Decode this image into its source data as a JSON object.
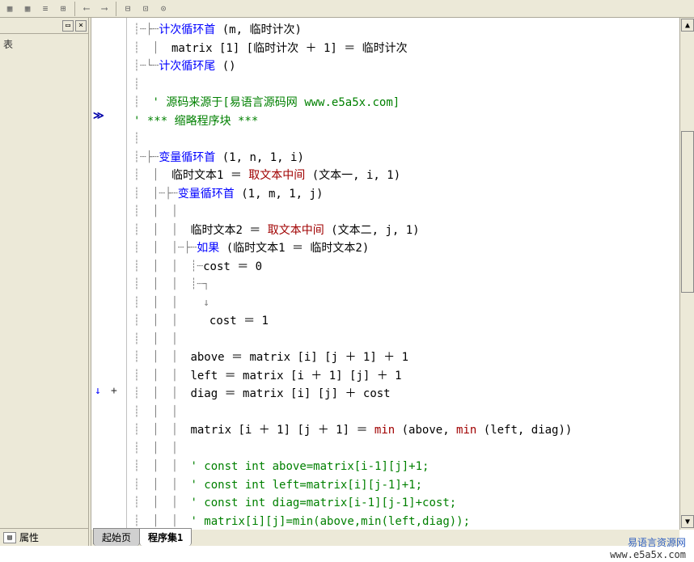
{
  "toolbar": {
    "tools": [
      "▦",
      "▦",
      "≡",
      "⊞",
      "|",
      "⟵",
      "⟶",
      "|",
      "⊟",
      "⊡",
      "⊙"
    ]
  },
  "leftPanel": {
    "hint": "表",
    "propTab": "属性"
  },
  "gutter": {
    "arrowLine": 20,
    "chevronLine": 5
  },
  "code": {
    "lines": [
      {
        "indent": "┊┄├┄",
        "parts": [
          {
            "c": "kw-blue",
            "t": "计次循环首"
          },
          {
            "c": "kw-black",
            "t": " (m, 临时计次)"
          }
        ]
      },
      {
        "indent": "┊  │  ",
        "parts": [
          {
            "c": "kw-black",
            "t": "matrix [1] [临时计次 ＋ 1] ＝ 临时计次"
          }
        ]
      },
      {
        "indent": "┊┄└┄",
        "parts": [
          {
            "c": "kw-blue",
            "t": "计次循环尾"
          },
          {
            "c": "kw-black",
            "t": " ()"
          }
        ]
      },
      {
        "indent": "┊",
        "parts": []
      },
      {
        "indent": "┊  ",
        "parts": [
          {
            "c": "kw-green",
            "t": "' 源码来源于[易语言源码网 www.e5a5x.com]"
          }
        ]
      },
      {
        "indent": "",
        "parts": [
          {
            "c": "kw-green",
            "t": "' *** 缩略程序块 ***"
          }
        ]
      },
      {
        "indent": "┊",
        "parts": []
      },
      {
        "indent": "┊┄├┄",
        "parts": [
          {
            "c": "kw-blue",
            "t": "变量循环首"
          },
          {
            "c": "kw-black",
            "t": " (1, n, 1, i)"
          }
        ]
      },
      {
        "indent": "┊  │  ",
        "parts": [
          {
            "c": "kw-black",
            "t": "临时文本1 ＝ "
          },
          {
            "c": "kw-red",
            "t": "取文本中间"
          },
          {
            "c": "kw-black",
            "t": " (文本一, i, 1)"
          }
        ]
      },
      {
        "indent": "┊  │┄├┄",
        "parts": [
          {
            "c": "kw-blue",
            "t": "变量循环首"
          },
          {
            "c": "kw-black",
            "t": " (1, m, 1, j)"
          }
        ]
      },
      {
        "indent": "┊  │  │",
        "parts": []
      },
      {
        "indent": "┊  │  │  ",
        "parts": [
          {
            "c": "kw-black",
            "t": "临时文本2 ＝ "
          },
          {
            "c": "kw-red",
            "t": "取文本中间"
          },
          {
            "c": "kw-black",
            "t": " (文本二, j, 1)"
          }
        ]
      },
      {
        "indent": "┊  │  │┄├┄",
        "parts": [
          {
            "c": "kw-blue",
            "t": "如果"
          },
          {
            "c": "kw-black",
            "t": " (临时文本1 ＝ 临时文本2)"
          }
        ]
      },
      {
        "indent": "┊  │  │  ┊┄",
        "parts": [
          {
            "c": "kw-black",
            "t": "cost ＝ 0"
          }
        ]
      },
      {
        "indent": "┊  │  │  ┊┄┐",
        "parts": []
      },
      {
        "indent": "┊  │  │    ↓",
        "parts": []
      },
      {
        "indent": "┊  │  │     ",
        "parts": [
          {
            "c": "kw-black",
            "t": "cost ＝ 1"
          }
        ]
      },
      {
        "indent": "┊  │  │",
        "parts": []
      },
      {
        "indent": "┊  │  │  ",
        "parts": [
          {
            "c": "kw-black",
            "t": "above ＝ matrix [i] [j ＋ 1] ＋ 1"
          }
        ]
      },
      {
        "indent": "┊  │  │  ",
        "parts": [
          {
            "c": "kw-black",
            "t": "left ＝ matrix [i ＋ 1] [j] ＋ 1"
          }
        ]
      },
      {
        "indent": "┊  │  │  ",
        "parts": [
          {
            "c": "kw-black",
            "t": "diag ＝ matrix [i] [j] ＋ cost"
          }
        ]
      },
      {
        "indent": "┊  │  │",
        "parts": []
      },
      {
        "indent": "┊  │  │  ",
        "parts": [
          {
            "c": "kw-black",
            "t": "matrix [i ＋ 1] [j ＋ 1] ＝ "
          },
          {
            "c": "kw-red",
            "t": "min"
          },
          {
            "c": "kw-black",
            "t": " (above, "
          },
          {
            "c": "kw-red",
            "t": "min"
          },
          {
            "c": "kw-black",
            "t": " (left, diag))"
          }
        ]
      },
      {
        "indent": "┊  │  │",
        "parts": []
      },
      {
        "indent": "┊  │  │  ",
        "parts": [
          {
            "c": "kw-green",
            "t": "' const int above=matrix[i-1][j]+1;"
          }
        ]
      },
      {
        "indent": "┊  │  │  ",
        "parts": [
          {
            "c": "kw-green",
            "t": "' const int left=matrix[i][j-1]+1;"
          }
        ]
      },
      {
        "indent": "┊  │  │  ",
        "parts": [
          {
            "c": "kw-green",
            "t": "' const int diag=matrix[i-1][j-1]+cost;"
          }
        ]
      },
      {
        "indent": "┊  │  │  ",
        "parts": [
          {
            "c": "kw-green",
            "t": "' matrix[i][j]=min(above,min(left,diag));"
          }
        ]
      }
    ]
  },
  "tabs": [
    {
      "label": "起始页",
      "active": false
    },
    {
      "label": "程序集1",
      "active": true
    }
  ],
  "watermark": {
    "cn": "易语言资源网",
    "url": "www.e5a5x.com"
  }
}
